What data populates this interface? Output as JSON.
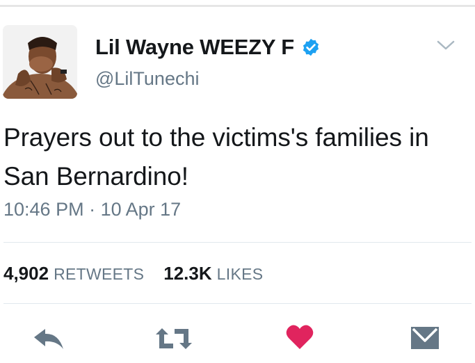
{
  "tweet": {
    "display_name": "Lil Wayne WEEZY F",
    "handle": "@LilTunechi",
    "text": "Prayers out to the victims's families in San Bernardino!",
    "time": "10:46 PM",
    "separator": "·",
    "date": "10 Apr 17"
  },
  "stats": {
    "retweets_count": "4,902",
    "retweets_label": "RETWEETS",
    "likes_count": "12.3K",
    "likes_label": "LIKES"
  },
  "icons": {
    "verified": "verified-badge-icon",
    "menu": "chevron-down-icon",
    "reply": "reply-icon",
    "retweet": "retweet-icon",
    "like": "heart-icon",
    "message": "envelope-icon"
  },
  "colors": {
    "verified_blue": "#1da1f2",
    "like_red": "#e0245e",
    "icon_gray": "#657786",
    "muted_text": "#657786",
    "divider": "#e1e8ed"
  }
}
